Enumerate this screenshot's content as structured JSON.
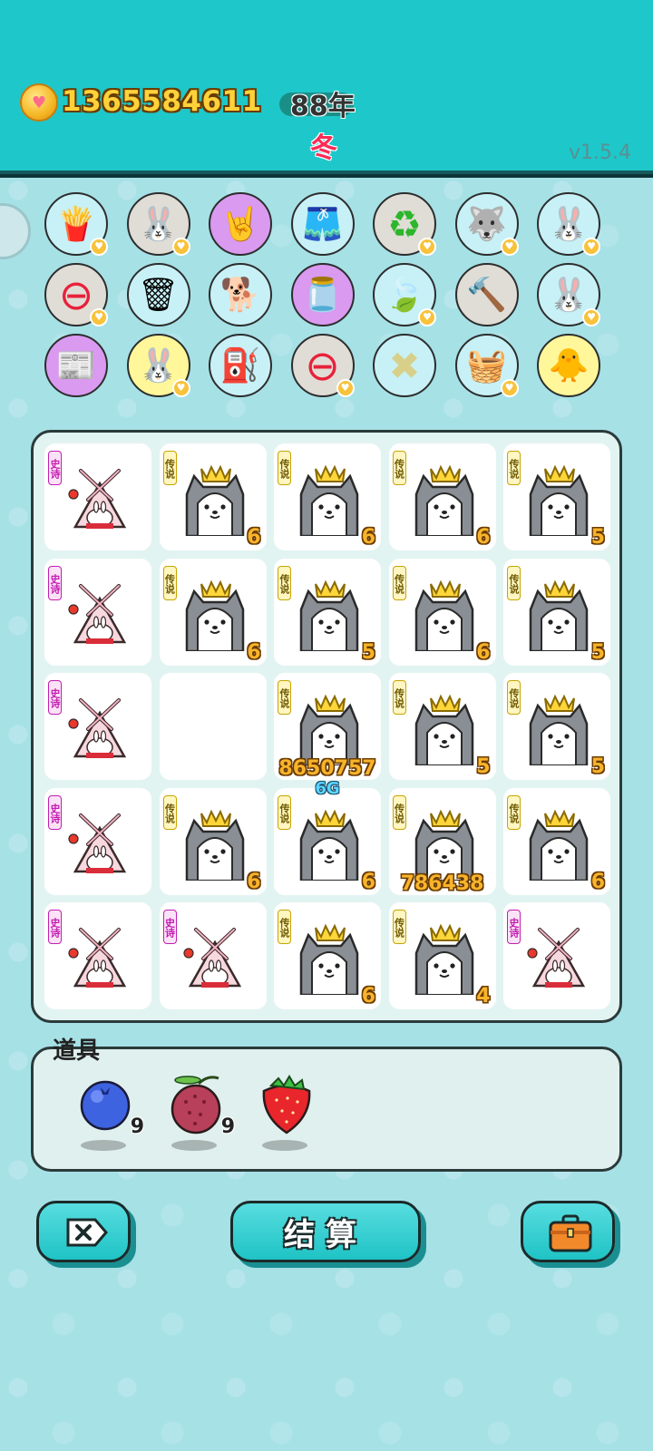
{
  "header": {
    "coin_amount": "1365584611",
    "year": "88年",
    "season": "冬",
    "version": "v1.5.4"
  },
  "items": [
    {
      "name": "fries",
      "emoji": "🍟",
      "bg": "#c7f1f6",
      "heart": true
    },
    {
      "name": "rabbit",
      "emoji": "🐰",
      "bg": "#e0ddd6",
      "heart": true
    },
    {
      "name": "rock-hand",
      "emoji": "🤘",
      "bg": "#d99af0",
      "heart": false
    },
    {
      "name": "skirt",
      "emoji": "🩳",
      "bg": "#c7f1f6",
      "heart": false
    },
    {
      "name": "recycle",
      "emoji": "♻",
      "bg": "#e0ddd6",
      "heart": true
    },
    {
      "name": "husky-sit",
      "emoji": "🐺",
      "bg": "#c7f1f6",
      "heart": true
    },
    {
      "name": "rabbit-2",
      "emoji": "🐰",
      "bg": "#c7f1f6",
      "heart": true
    },
    {
      "name": "minus",
      "emoji": "⊖",
      "bg": "#e0ddd6",
      "heart": true
    },
    {
      "name": "garbage-bag",
      "emoji": "🗑",
      "bg": "#c7f1f6",
      "heart": false
    },
    {
      "name": "dog-sunglasses",
      "emoji": "🐕",
      "bg": "#c7f1f6",
      "heart": false
    },
    {
      "name": "jar",
      "emoji": "🫙",
      "bg": "#d99af0",
      "heart": false
    },
    {
      "name": "leaf",
      "emoji": "🍃",
      "bg": "#c7f1f6",
      "heart": true
    },
    {
      "name": "hammer",
      "emoji": "🔨",
      "bg": "#e0ddd6",
      "heart": false
    },
    {
      "name": "rabbit-3",
      "emoji": "🐰",
      "bg": "#c7f1f6",
      "heart": true
    },
    {
      "name": "time-magazine",
      "emoji": "📰",
      "bg": "#d99af0",
      "heart": false
    },
    {
      "name": "rabbit-4",
      "emoji": "🐰",
      "bg": "#fff79a",
      "heart": true
    },
    {
      "name": "pump",
      "emoji": "⛽",
      "bg": "#c7f1f6",
      "heart": false
    },
    {
      "name": "minus-2",
      "emoji": "⊖",
      "bg": "#e0ddd6",
      "heart": true
    },
    {
      "name": "straws",
      "emoji": "✖",
      "bg": "#c7f1f6",
      "heart": false
    },
    {
      "name": "fruit-basket",
      "emoji": "🧺",
      "bg": "#c7f1f6",
      "heart": true
    },
    {
      "name": "chick-egg",
      "emoji": "🐥",
      "bg": "#fff79a",
      "heart": false
    }
  ],
  "board": [
    {
      "type": "tent",
      "tag": "史诗",
      "count": ""
    },
    {
      "type": "husky",
      "tag": "传说",
      "count": "6"
    },
    {
      "type": "husky",
      "tag": "传说",
      "count": "6"
    },
    {
      "type": "husky",
      "tag": "传说",
      "count": "6"
    },
    {
      "type": "husky",
      "tag": "传说",
      "count": "5"
    },
    {
      "type": "tent",
      "tag": "史诗",
      "count": ""
    },
    {
      "type": "husky",
      "tag": "传说",
      "count": "6"
    },
    {
      "type": "husky",
      "tag": "传说",
      "count": "5"
    },
    {
      "type": "husky",
      "tag": "传说",
      "count": "6"
    },
    {
      "type": "husky",
      "tag": "传说",
      "count": "5"
    },
    {
      "type": "tent",
      "tag": "史诗",
      "count": ""
    },
    {
      "type": "empty",
      "tag": "",
      "count": ""
    },
    {
      "type": "husky",
      "tag": "传说",
      "count": "",
      "big": "8650757"
    },
    {
      "type": "husky",
      "tag": "传说",
      "count": "5"
    },
    {
      "type": "husky",
      "tag": "传说",
      "count": "5"
    },
    {
      "type": "tent",
      "tag": "史诗",
      "count": ""
    },
    {
      "type": "husky",
      "tag": "传说",
      "count": "6"
    },
    {
      "type": "husky",
      "tag": "传说",
      "count": "6",
      "top": "6G"
    },
    {
      "type": "husky",
      "tag": "传说",
      "count": "",
      "big": "786438"
    },
    {
      "type": "husky",
      "tag": "传说",
      "count": "6"
    },
    {
      "type": "tent",
      "tag": "史诗",
      "count": ""
    },
    {
      "type": "tent",
      "tag": "史诗",
      "count": ""
    },
    {
      "type": "husky",
      "tag": "传说",
      "count": "6"
    },
    {
      "type": "husky",
      "tag": "传说",
      "count": "4"
    },
    {
      "type": "tent",
      "tag": "史诗",
      "count": ""
    }
  ],
  "props": {
    "title": "道具",
    "list": [
      {
        "name": "blueberry",
        "count": "9",
        "color": "#3e63e0"
      },
      {
        "name": "bayberry",
        "count": "9",
        "color": "#b8405a"
      },
      {
        "name": "strawberry",
        "count": "",
        "color": "#e8262c"
      }
    ]
  },
  "buttons": {
    "settle_label": "结算"
  }
}
